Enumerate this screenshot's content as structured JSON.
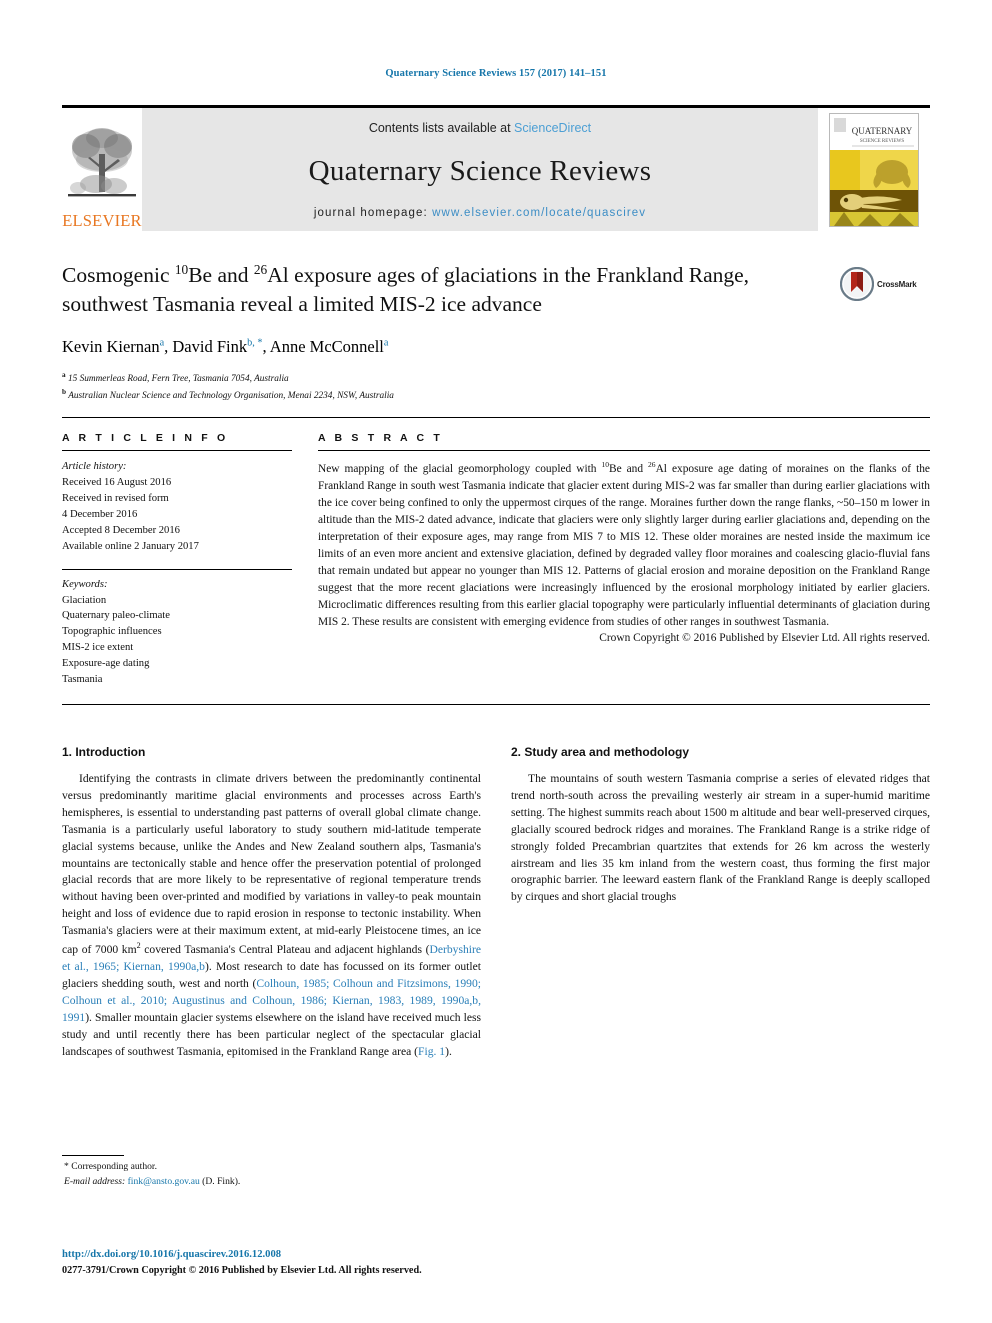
{
  "running_head": "Quaternary Science Reviews 157 (2017) 141–151",
  "masthead": {
    "publisher_name": "ELSEVIER",
    "contents_prefix": "Contents lists available at ",
    "contents_link": "ScienceDirect",
    "journal_title": "Quaternary Science Reviews",
    "homepage_prefix": "journal homepage: ",
    "homepage_link": "www.elsevier.com/locate/quascirev",
    "cover_title_line1": "QUATERNARY",
    "cover_title_line2": "SCIENCE REVIEWS"
  },
  "article": {
    "title_part1": "Cosmogenic ",
    "title_sup1": "10",
    "title_part2": "Be and ",
    "title_sup2": "26",
    "title_part3": "Al exposure ages of glaciations in the Frankland Range, southwest Tasmania reveal a limited MIS-2 ice advance",
    "authors_text": "Kevin Kiernan , David Fink , Anne McConnell",
    "author1": "Kevin Kiernan",
    "author1_sup": "a",
    "author2": "David Fink",
    "author2_sup": "b, *",
    "author3": "Anne McConnell",
    "author3_sup": "a",
    "affiliation_a_sup": "a",
    "affiliation_a": "15 Summerleas Road, Fern Tree, Tasmania 7054, Australia",
    "affiliation_b_sup": "b",
    "affiliation_b": "Australian Nuclear Science and Technology Organisation, Menai 2234, NSW, Australia",
    "crossmark_label": "CrossMark"
  },
  "article_info": {
    "heading": "A R T I C L E    I N F O",
    "history_label": "Article history:",
    "history": [
      "Received 16 August 2016",
      "Received in revised form",
      "4 December 2016",
      "Accepted 8 December 2016",
      "Available online 2 January 2017"
    ],
    "keywords_label": "Keywords:",
    "keywords": [
      "Glaciation",
      "Quaternary paleo-climate",
      "Topographic influences",
      "MIS-2 ice extent",
      "Exposure-age dating",
      "Tasmania"
    ]
  },
  "abstract": {
    "heading": "A B S T R A C T",
    "p1": "New mapping of the glacial geomorphology coupled with ",
    "sup1": "10",
    "p2": "Be and ",
    "sup2": "26",
    "p3": "Al exposure age dating of moraines on the flanks of the Frankland Range in south west Tasmania indicate that glacier extent during MIS-2 was far smaller than during earlier glaciations with the ice cover being confined to only the uppermost cirques of the range. Moraines further down the range flanks, ~50–150 m lower in altitude than the MIS-2 dated advance, indicate that glaciers were only slightly larger during earlier glaciations and, depending on the interpretation of their exposure ages, may range from MIS 7 to MIS 12. These older moraines are nested inside the maximum ice limits of an even more ancient and extensive glaciation, defined by degraded valley floor moraines and coalescing glacio-fluvial fans that remain undated but appear no younger than MIS 12. Patterns of glacial erosion and moraine deposition on the Frankland Range suggest that the more recent glaciations were increasingly influenced by the erosional morphology initiated by earlier glaciers. Microclimatic differences resulting from this earlier glacial topography were particularly influential determinants of glaciation during MIS 2. These results are consistent with emerging evidence from studies of other ranges in southwest Tasmania.",
    "copyright": "Crown Copyright © 2016 Published by Elsevier Ltd. All rights reserved."
  },
  "body": {
    "section1_heading": "1. Introduction",
    "section1_p1_a": "Identifying the contrasts in climate drivers between the predominantly continental versus predominantly maritime glacial environments and processes across Earth's hemispheres, is essential to understanding past patterns of overall global climate change. Tasmania is a particularly useful laboratory to study southern mid-latitude temperate glacial systems because, unlike the Andes and New Zealand southern alps, Tasmania's mountains are tectonically stable and hence offer the preservation potential of prolonged glacial records that are more likely to be representative of regional temperature trends without having been over-printed and modified by variations in valley-to peak mountain height and loss of evidence due to rapid erosion in response to tectonic instability. When Tasmania's glaciers were at their maximum extent, at mid-early Pleistocene times, an ice cap of 7000 km",
    "section1_p1_sup": "2",
    "section1_p1_b": " covered Tasmania's Central Plateau and adjacent highlands (",
    "section1_ref1": "Derbyshire et al., 1965; Kiernan, 1990a,b",
    "section1_p1_c": "). Most research to date has focussed on its former outlet glaciers shedding south, west and north (",
    "section1_ref2": "Colhoun, 1985; Colhoun and Fitzsimons, 1990; Colhoun et al., 2010; Augustinus and Colhoun, 1986; Kiernan, 1983, 1989, 1990a,b, 1991",
    "section1_p1_d": "). Smaller mountain glacier systems elsewhere on the island have received much less study and until recently there has been particular neglect of the spectacular glacial landscapes of southwest Tasmania, epitomised in the Frankland Range area (",
    "section1_ref3": "Fig. 1",
    "section1_p1_e": ").",
    "section2_heading": "2. Study area and methodology",
    "section2_p1": "The mountains of south western Tasmania comprise a series of elevated ridges that trend north-south across the prevailing westerly air stream in a super-humid maritime setting. The highest summits reach about 1500 m altitude and bear well-preserved cirques, glacially scoured bedrock ridges and moraines. The Frankland Range is a strike ridge of strongly folded Precambrian quartzites that extends for 26 km across the westerly airstream and lies 35 km inland from the western coast, thus forming the first major orographic barrier. The leeward eastern flank of the Frankland Range is deeply scalloped by cirques and short glacial troughs"
  },
  "footnote": {
    "corresponding": "* Corresponding author.",
    "email_label": "E-mail address:",
    "email": "fink@ansto.gov.au",
    "email_suffix": " (D. Fink)."
  },
  "footer": {
    "doi": "http://dx.doi.org/10.1016/j.quascirev.2016.12.008",
    "issn_copyright": "0277-3791/Crown Copyright © 2016 Published by Elsevier Ltd. All rights reserved."
  },
  "colors": {
    "link_blue": "#1676aa",
    "ref_blue": "#2a7fb8",
    "elsevier_orange": "#e87722",
    "masthead_grey": "#e6e6e6",
    "crossmark_red": "#b3261a",
    "cover_yellow": "#e8c71e"
  }
}
